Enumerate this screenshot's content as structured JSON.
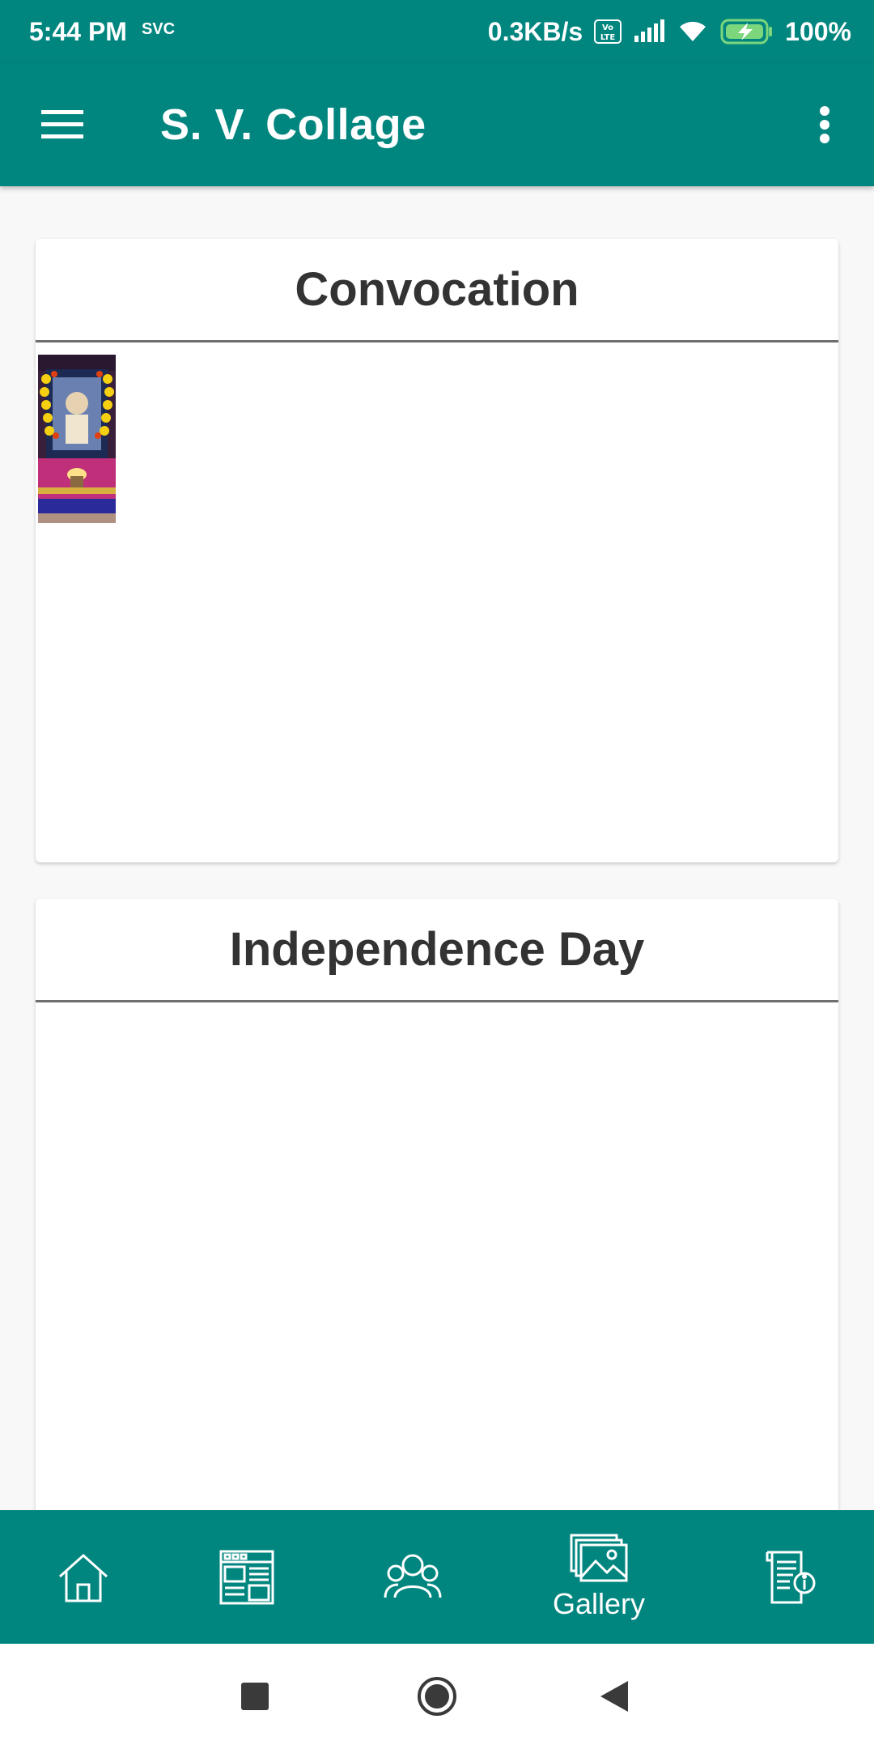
{
  "status_bar": {
    "time": "5:44 PM",
    "carrier": "SVC",
    "speed": "0.3KB/s",
    "battery": "100%"
  },
  "app_bar": {
    "title": "S. V. Collage"
  },
  "cards": [
    {
      "title": "Convocation"
    },
    {
      "title": "Independence Day"
    }
  ],
  "bottom_nav": {
    "items": [
      {
        "icon": "home-icon",
        "label": ""
      },
      {
        "icon": "news-icon",
        "label": ""
      },
      {
        "icon": "people-icon",
        "label": ""
      },
      {
        "icon": "gallery-icon",
        "label": "Gallery"
      },
      {
        "icon": "info-document-icon",
        "label": ""
      }
    ],
    "active_index": 3
  },
  "colors": {
    "primary": "#00867f",
    "title_text": "#333333"
  }
}
